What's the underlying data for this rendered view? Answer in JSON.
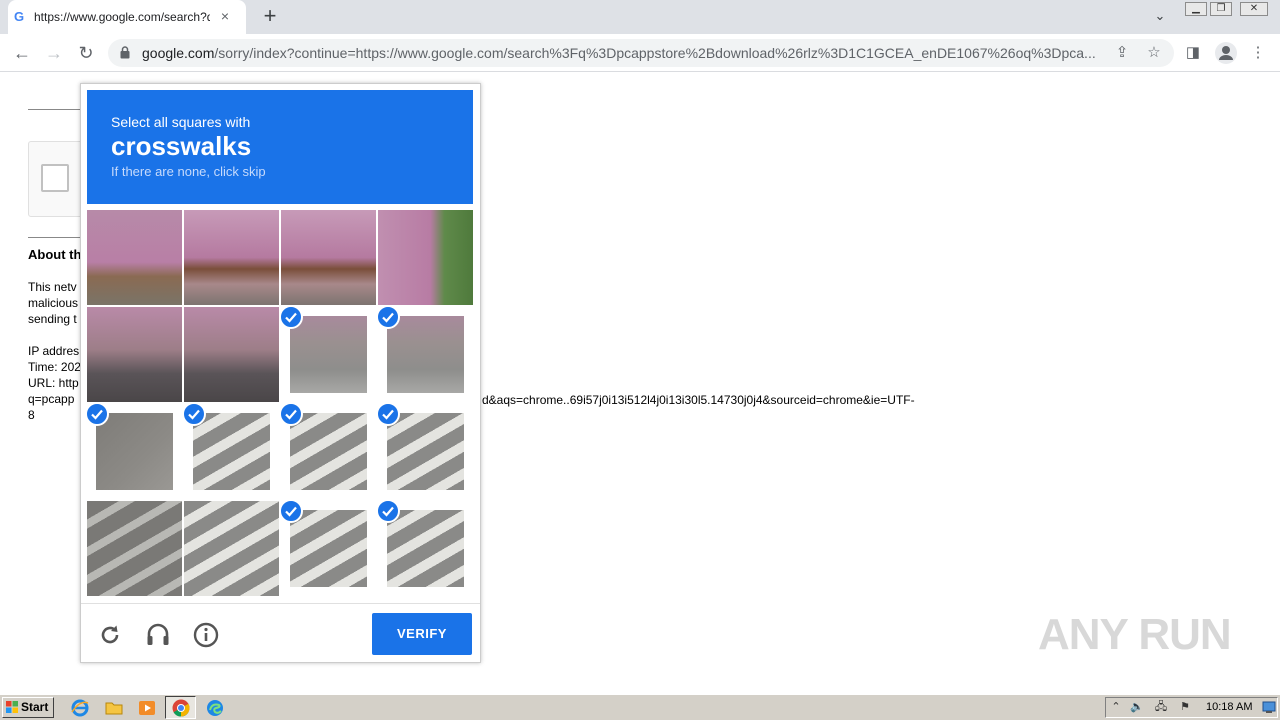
{
  "browser": {
    "tab_title": "https://www.google.com/search?q=",
    "tab_favicon": "G",
    "tab_close": "×",
    "new_tab": "+",
    "url_host": "google.com",
    "url_rest": "/sorry/index?continue=https://www.google.com/search%3Fq%3Dpcappstore%2Bdownload%26rlz%3D1C1GCEA_enDE1067%26oq%3Dpca..."
  },
  "page": {
    "about_heading": "About th",
    "lines": [
      "This netv",
      "malicious",
      "sending t",
      "",
      "IP addres",
      "Time: 202",
      "URL: http",
      "q=pcapp",
      "8"
    ],
    "url_tail": "d&aqs=chrome..69i57j0i13i512l4j0i13i30l5.14730j0j4&sourceid=chrome&ie=UTF-"
  },
  "captcha": {
    "instruction": "Select all squares with",
    "keyword": "crosswalks",
    "subtext": "If there are none, click skip",
    "verify_label": "VERIFY",
    "tiles": [
      {
        "row": 0,
        "col": 0,
        "selected": false,
        "scene": "storefront-sign"
      },
      {
        "row": 0,
        "col": 1,
        "selected": false,
        "scene": "storefront"
      },
      {
        "row": 0,
        "col": 2,
        "selected": false,
        "scene": "storefront"
      },
      {
        "row": 0,
        "col": 3,
        "selected": false,
        "scene": "storefront-tree"
      },
      {
        "row": 1,
        "col": 0,
        "selected": false,
        "scene": "pedestrians"
      },
      {
        "row": 1,
        "col": 1,
        "selected": false,
        "scene": "pedestrians"
      },
      {
        "row": 1,
        "col": 2,
        "selected": true,
        "scene": "street-corner"
      },
      {
        "row": 1,
        "col": 3,
        "selected": true,
        "scene": "street-corner"
      },
      {
        "row": 2,
        "col": 0,
        "selected": true,
        "scene": "asphalt"
      },
      {
        "row": 2,
        "col": 1,
        "selected": true,
        "scene": "crosswalk"
      },
      {
        "row": 2,
        "col": 2,
        "selected": true,
        "scene": "crosswalk"
      },
      {
        "row": 2,
        "col": 3,
        "selected": true,
        "scene": "crosswalk"
      },
      {
        "row": 3,
        "col": 0,
        "selected": false,
        "scene": "crosswalk-faded"
      },
      {
        "row": 3,
        "col": 1,
        "selected": false,
        "scene": "crosswalk"
      },
      {
        "row": 3,
        "col": 2,
        "selected": true,
        "scene": "crosswalk"
      },
      {
        "row": 3,
        "col": 3,
        "selected": true,
        "scene": "crosswalk"
      }
    ]
  },
  "watermark": "ANY RUN",
  "taskbar": {
    "start_label": "Start",
    "clock": "10:18 AM"
  },
  "colors": {
    "accent": "#1a73e8",
    "tabstrip": "#dee1e6",
    "taskbar": "#d4d0c8"
  }
}
